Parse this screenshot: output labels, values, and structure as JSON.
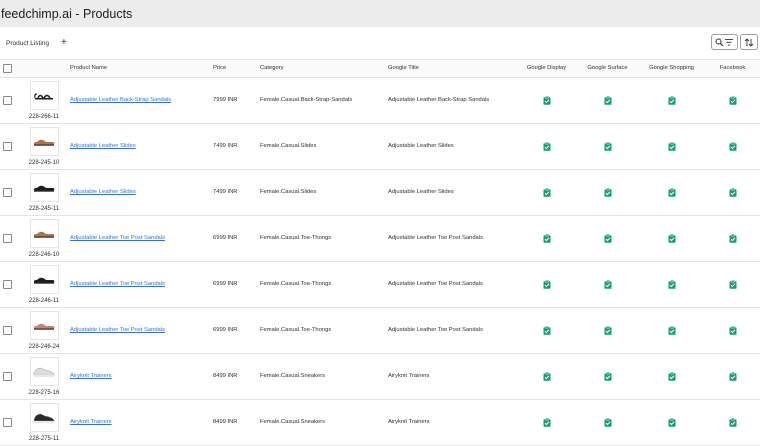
{
  "app": {
    "title": "feedchimp.ai - Products"
  },
  "tabs": {
    "product_listing": "Product Listing",
    "add_label": "+"
  },
  "colors": {
    "channel_icon": "#17a06a",
    "link": "#3b6fd8"
  },
  "table": {
    "headers": {
      "product_name": "Product Name",
      "price": "Price",
      "category": "Category",
      "google_title": "Google Title",
      "google_display": "Google Display",
      "google_surface": "Google Surface",
      "google_shopping": "Google Shopping",
      "facebook": "Facebook"
    },
    "rows": [
      {
        "sku": "228-266-11",
        "name": "Adjustable Leather Back-Strap Sandals",
        "price": "7999 INR",
        "category": "Female.Casual.Back-Strap-Sandals",
        "google_title": "Adjustable Leather Back-Strap Sandals",
        "thumb_color": "#1e1e1e",
        "thumb_kind": "sandal"
      },
      {
        "sku": "228-245-10",
        "name": "Adjustable Leather Slides",
        "price": "7499 INR",
        "category": "Female.Casual.Slides",
        "google_title": "Adjustable Leather Slides",
        "thumb_color": "#b5734a",
        "thumb_kind": "slide"
      },
      {
        "sku": "228-245-11",
        "name": "Adjustable Leather Slides",
        "price": "7499 INR",
        "category": "Female.Casual.Slides",
        "google_title": "Adjustable Leather Slides",
        "thumb_color": "#1e1e1e",
        "thumb_kind": "slide"
      },
      {
        "sku": "228-246-10",
        "name": "Adjustable Leather Toe Post Sandals",
        "price": "6999 INR",
        "category": "Female.Casual.Toe-Thongs",
        "google_title": "Adjustable Leather Toe Post Sandals",
        "thumb_color": "#b5734a",
        "thumb_kind": "slide"
      },
      {
        "sku": "228-246-11",
        "name": "Adjustable Leather Toe Post Sandals",
        "price": "6999 INR",
        "category": "Female.Casual.Toe-Thongs",
        "google_title": "Adjustable Leather Toe Post Sandals",
        "thumb_color": "#1e1e1e",
        "thumb_kind": "slide"
      },
      {
        "sku": "228-246-24",
        "name": "Adjustable Leather Toe Post Sandals",
        "price": "6999 INR",
        "category": "Female.Casual.Toe-Thongs",
        "google_title": "Adjustable Leather Toe Post Sandals",
        "thumb_color": "#c98276",
        "thumb_kind": "slide"
      },
      {
        "sku": "228-275-16",
        "name": "Airyknit Trainers",
        "price": "8499 INR",
        "category": "Female.Casual.Sneakers",
        "google_title": "Airyknit Trainers",
        "thumb_color": "#dcdcdc",
        "thumb_kind": "sneaker"
      },
      {
        "sku": "228-275-11",
        "name": "Airyknit Trainers",
        "price": "8499 INR",
        "category": "Female.Casual.Sneakers",
        "google_title": "Airyknit Trainers",
        "thumb_color": "#2a2a2a",
        "thumb_kind": "sneaker"
      }
    ]
  },
  "icons": {
    "search": "search-icon",
    "filter": "filter-icon",
    "sort": "sort-icon",
    "add": "plus-icon",
    "channel_status": "clipboard-check-icon"
  }
}
